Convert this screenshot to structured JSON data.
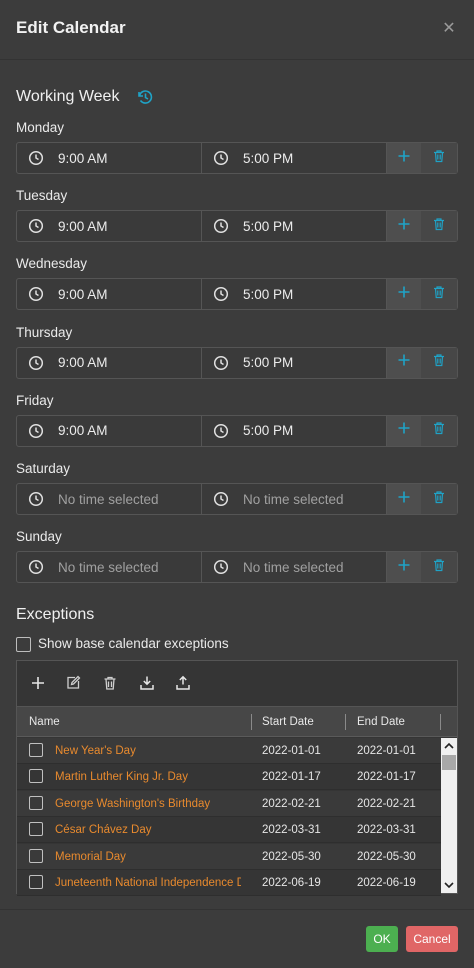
{
  "dialog": {
    "title": "Edit Calendar",
    "close_glyph": "✕"
  },
  "working_week": {
    "title": "Working Week",
    "days": [
      {
        "name": "Monday",
        "start": "9:00 AM",
        "end": "5:00 PM"
      },
      {
        "name": "Tuesday",
        "start": "9:00 AM",
        "end": "5:00 PM"
      },
      {
        "name": "Wednesday",
        "start": "9:00 AM",
        "end": "5:00 PM"
      },
      {
        "name": "Thursday",
        "start": "9:00 AM",
        "end": "5:00 PM"
      },
      {
        "name": "Friday",
        "start": "9:00 AM",
        "end": "5:00 PM"
      },
      {
        "name": "Saturday",
        "start": "No time selected",
        "end": "No time selected"
      },
      {
        "name": "Sunday",
        "start": "No time selected",
        "end": "No time selected"
      }
    ]
  },
  "exceptions": {
    "title": "Exceptions",
    "show_base_label": "Show base calendar exceptions",
    "columns": [
      "Name",
      "Start Date",
      "End Date"
    ],
    "rows": [
      {
        "name": "New Year's Day",
        "start": "2022-01-01",
        "end": "2022-01-01"
      },
      {
        "name": "Martin Luther King Jr. Day",
        "start": "2022-01-17",
        "end": "2022-01-17"
      },
      {
        "name": "George Washington's Birthday",
        "start": "2022-02-21",
        "end": "2022-02-21"
      },
      {
        "name": "César Chávez Day",
        "start": "2022-03-31",
        "end": "2022-03-31"
      },
      {
        "name": "Memorial Day",
        "start": "2022-05-30",
        "end": "2022-05-30"
      },
      {
        "name": "Juneteenth National Independence Day",
        "start": "2022-06-19",
        "end": "2022-06-19"
      }
    ]
  },
  "footer": {
    "ok_label": "OK",
    "cancel_label": "Cancel"
  },
  "colors": {
    "accent": "#1fa3c7",
    "holiday_text": "#e88a2e",
    "ok": "#4caf50",
    "cancel": "#e06666"
  }
}
